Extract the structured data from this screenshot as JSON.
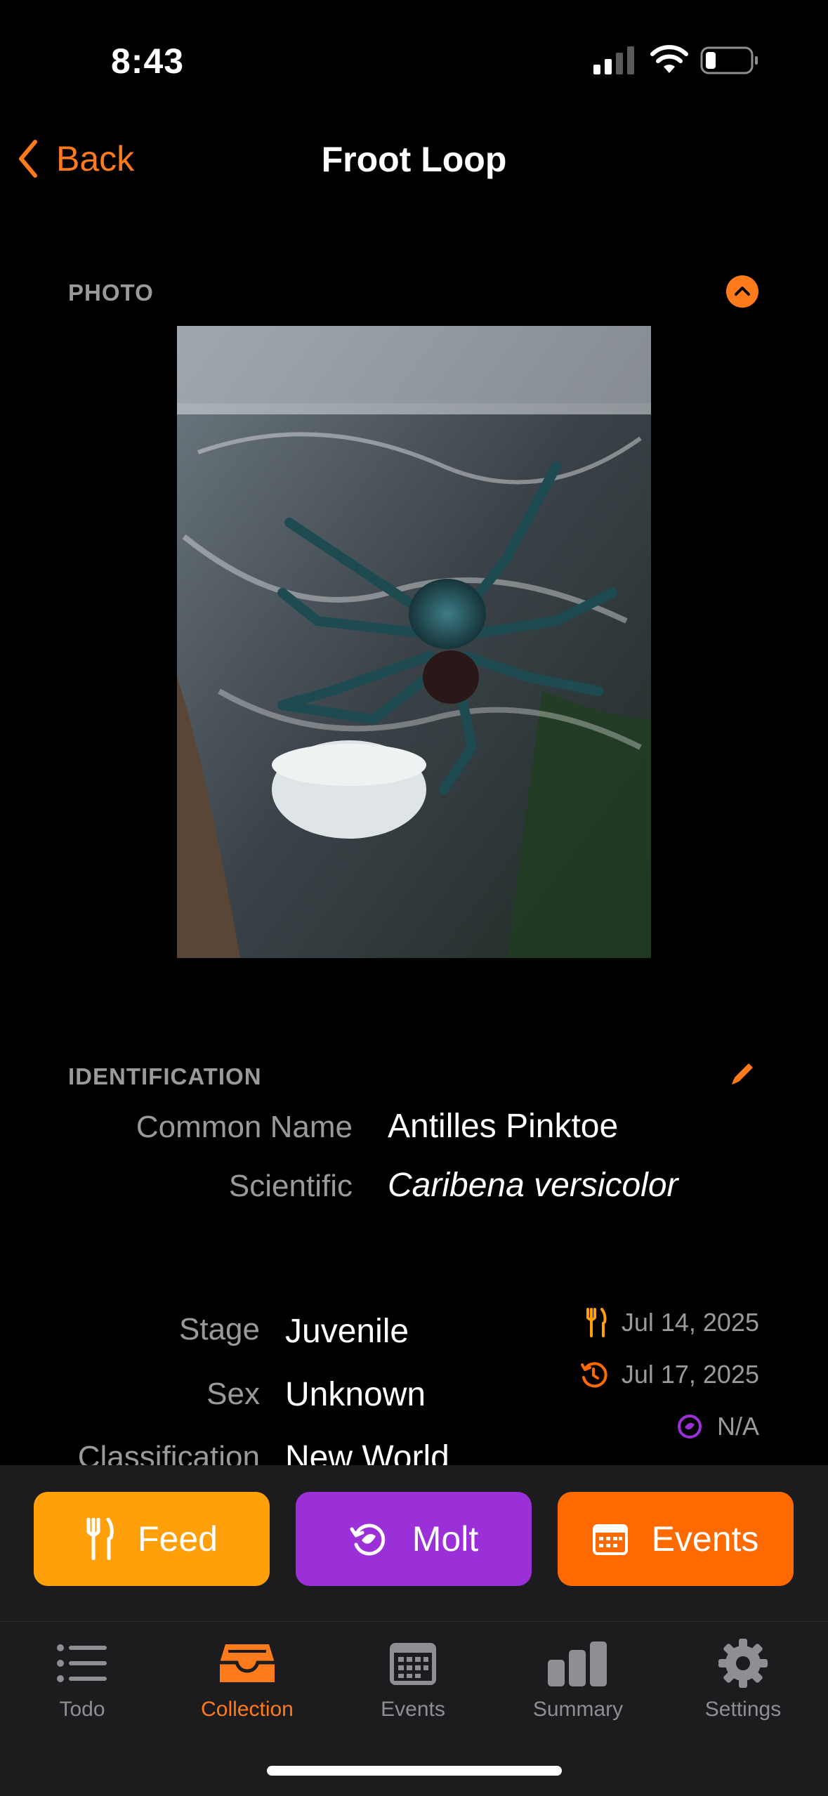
{
  "status": {
    "time": "8:43"
  },
  "nav": {
    "back_label": "Back",
    "title": "Froot Loop"
  },
  "photo_section": {
    "label": "PHOTO"
  },
  "identification": {
    "label": "IDENTIFICATION",
    "common_name_label": "Common Name",
    "common_name": "Antilles Pinktoe",
    "scientific_label": "Scientific",
    "scientific": "Caribena versicolor"
  },
  "details": {
    "stage_label": "Stage",
    "stage": "Juvenile",
    "sex_label": "Sex",
    "sex": "Unknown",
    "classification_label": "Classification",
    "classification": "New World",
    "last_fed": "Jul 14, 2025",
    "last_event": "Jul 17, 2025",
    "last_molt": "N/A"
  },
  "actions": {
    "feed": "Feed",
    "molt": "Molt",
    "events": "Events"
  },
  "tabs": [
    {
      "label": "Todo",
      "icon": "list-icon"
    },
    {
      "label": "Collection",
      "icon": "tray-icon"
    },
    {
      "label": "Events",
      "icon": "calendar-icon"
    },
    {
      "label": "Summary",
      "icon": "bar-chart-icon"
    },
    {
      "label": "Settings",
      "icon": "gear-icon"
    }
  ],
  "colors": {
    "accent": "#ff7a1a",
    "feed": "#ff9f0a",
    "molt": "#9b30d9",
    "events": "#ff6a00",
    "bar_bg": "#1c1c1e"
  }
}
